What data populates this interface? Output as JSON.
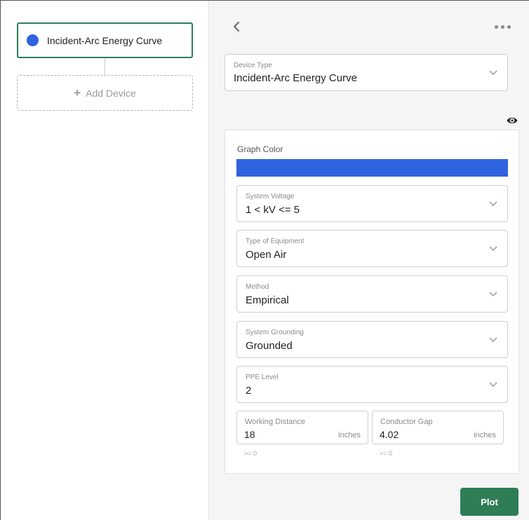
{
  "left_panel": {
    "device": {
      "label": "Incident-Arc Energy Curve",
      "color": "#2f63e0"
    },
    "add_device_label": "Add Device"
  },
  "right_panel": {
    "device_type": {
      "label": "Device Type",
      "value": "Incident-Arc Energy Curve"
    },
    "graph_color": {
      "label": "Graph Color",
      "color": "#2f63e0"
    },
    "system_voltage": {
      "label": "System Voltage",
      "value": "1 < kV <= 5"
    },
    "type_of_equipment": {
      "label": "Type of Equipment",
      "value": "Open Air"
    },
    "method": {
      "label": "Method",
      "value": "Empirical"
    },
    "system_grounding": {
      "label": "System Grounding",
      "value": "Grounded"
    },
    "ppe_level": {
      "label": "PPE Level",
      "value": "2"
    },
    "working_distance": {
      "label": "Working Distance",
      "value": "18",
      "unit": "inches",
      "hint": ">= 0"
    },
    "conductor_gap": {
      "label": "Conductor Gap",
      "value": "4.02",
      "unit": "inches",
      "hint": ">= 0"
    },
    "plot_label": "Plot"
  },
  "icons": {
    "back": "chevron-left-icon",
    "more": "more-horizontal-icon",
    "visibility": "eye-icon",
    "dropdown": "chevron-down-icon",
    "add": "plus-icon"
  },
  "colors": {
    "accent_green": "#2e7d57",
    "series_blue": "#2f63e0"
  }
}
